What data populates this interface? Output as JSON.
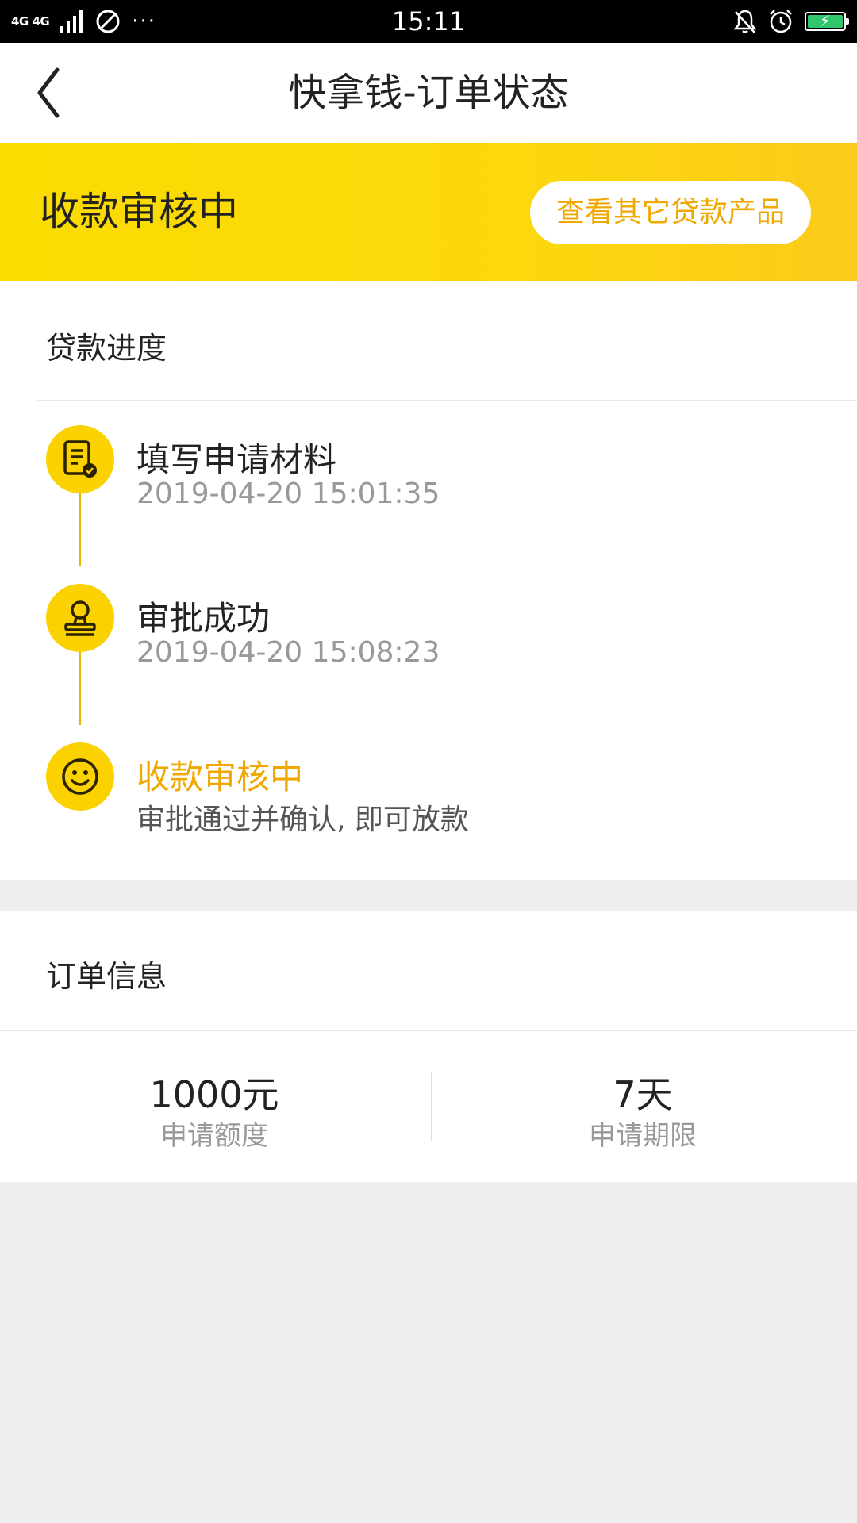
{
  "status_bar": {
    "network": "4G 4G",
    "time": "15:11",
    "more": "···"
  },
  "nav": {
    "title": "快拿钱-订单状态"
  },
  "banner": {
    "status": "收款审核中",
    "button_label": "查看其它贷款产品"
  },
  "progress": {
    "section_title": "贷款进度",
    "steps": [
      {
        "title": "填写申请材料",
        "subtitle": "2019-04-20 15:01:35",
        "icon": "document-check-icon"
      },
      {
        "title": "审批成功",
        "subtitle": "2019-04-20 15:08:23",
        "icon": "stamp-icon"
      },
      {
        "title": "收款审核中",
        "subtitle": "审批通过并确认, 即可放款",
        "icon": "smile-icon"
      }
    ]
  },
  "order": {
    "section_title": "订单信息",
    "amount_value": "1000元",
    "amount_label": "申请额度",
    "term_value": "7天",
    "term_label": "申请期限"
  },
  "colors": {
    "accent_yellow": "#fbd100",
    "accent_orange_text": "#f0a800",
    "battery_green": "#2fc66c"
  }
}
